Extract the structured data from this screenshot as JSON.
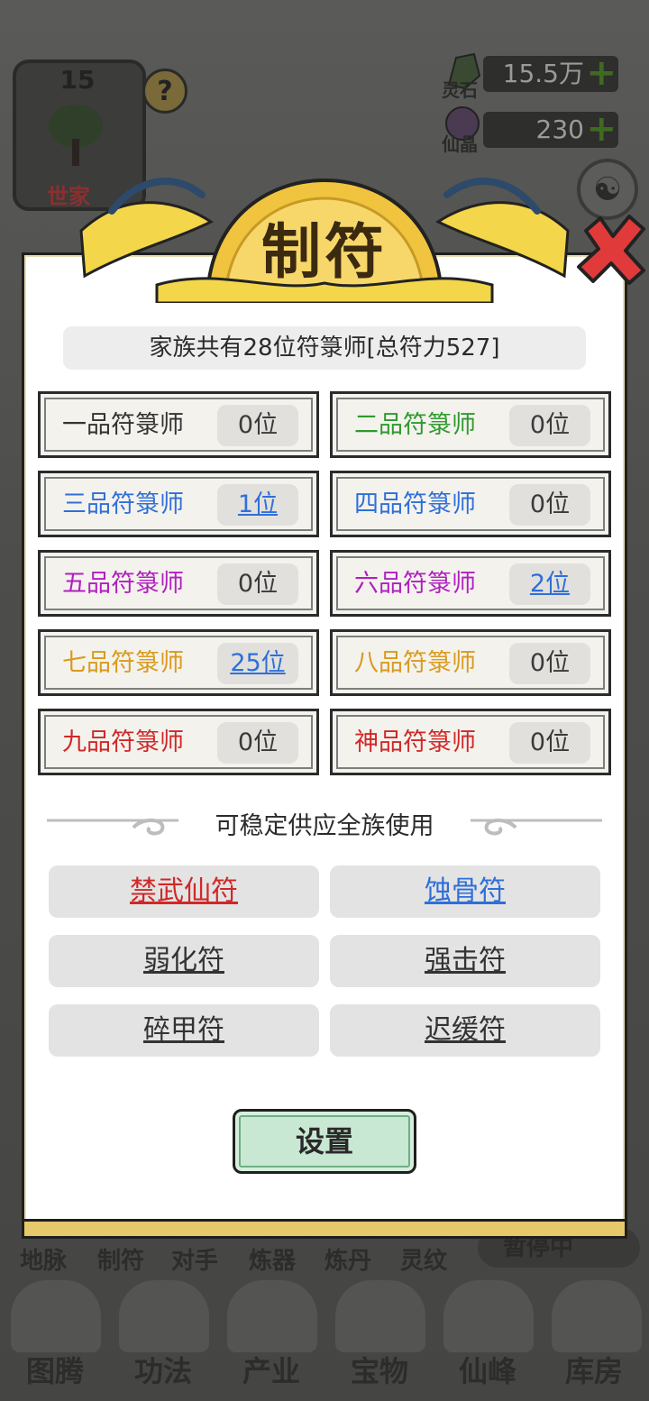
{
  "hud": {
    "level": "15",
    "clan_tier": "世家",
    "help": "?",
    "lingshi_label": "灵石",
    "lingshi_value": "15.5万",
    "xianjing_label": "仙晶",
    "xianjing_value": "230",
    "plus": "+"
  },
  "dialog": {
    "title": "制符",
    "summary": "家族共有28位符箓师[总符力527]",
    "grades": [
      {
        "name": "一品符箓师",
        "count": "0位",
        "color": "#333333",
        "link": false
      },
      {
        "name": "二品符箓师",
        "count": "0位",
        "color": "#2e9a2e",
        "link": false
      },
      {
        "name": "三品符箓师",
        "count": "1位",
        "color": "#2f6fd8",
        "link": true
      },
      {
        "name": "四品符箓师",
        "count": "0位",
        "color": "#2f6fd8",
        "link": false
      },
      {
        "name": "五品符箓师",
        "count": "0位",
        "color": "#b020c0",
        "link": false
      },
      {
        "name": "六品符箓师",
        "count": "2位",
        "color": "#b020c0",
        "link": true
      },
      {
        "name": "七品符箓师",
        "count": "25位",
        "color": "#d99a1e",
        "link": true
      },
      {
        "name": "八品符箓师",
        "count": "0位",
        "color": "#d99a1e",
        "link": false
      },
      {
        "name": "九品符箓师",
        "count": "0位",
        "color": "#d02828",
        "link": false
      },
      {
        "name": "神品符箓师",
        "count": "0位",
        "color": "#d02828",
        "link": false
      }
    ],
    "supply_heading": "可稳定供应全族使用",
    "talismans": [
      {
        "name": "禁武仙符",
        "color": "#d02828"
      },
      {
        "name": "蚀骨符",
        "color": "#2f6fd8"
      },
      {
        "name": "弱化符",
        "color": "#333333"
      },
      {
        "name": "强击符",
        "color": "#333333"
      },
      {
        "name": "碎甲符",
        "color": "#333333"
      },
      {
        "name": "迟缓符",
        "color": "#333333"
      }
    ],
    "settings_button": "设置"
  },
  "bottom": {
    "sub_tabs": [
      "地脉",
      "制符",
      "对手",
      "炼器",
      "炼丹",
      "灵纹"
    ],
    "pause": "暂停中",
    "main_tabs": [
      "图腾",
      "功法",
      "产业",
      "宝物",
      "仙峰",
      "库房"
    ]
  }
}
